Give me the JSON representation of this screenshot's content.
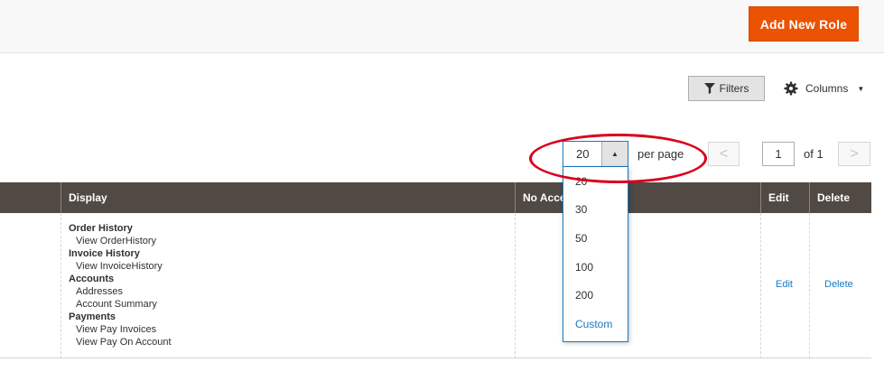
{
  "header": {
    "add_button_label": "Add New Role"
  },
  "toolbar": {
    "filters_label": "Filters",
    "columns_label": "Columns",
    "icons": [
      "filter-icon",
      "gear-icon",
      "caret-down-icon"
    ]
  },
  "pagination": {
    "per_page_value": "20",
    "per_page_label": "per page",
    "options": [
      "20",
      "30",
      "50",
      "100",
      "200",
      "Custom"
    ],
    "current_page": "1",
    "total_pages_label": "of 1",
    "prev_glyph": "<",
    "next_glyph": ">"
  },
  "grid": {
    "columns": [
      "Display",
      "No Access",
      "Edit",
      "Delete"
    ],
    "row": {
      "permissions": [
        {
          "group": "Order History",
          "items": [
            "View OrderHistory"
          ]
        },
        {
          "group": "Invoice History",
          "items": [
            "View InvoiceHistory"
          ]
        },
        {
          "group": "Accounts",
          "items": [
            "Addresses",
            "Account Summary"
          ]
        },
        {
          "group": "Payments",
          "items": [
            "View Pay Invoices",
            "View Pay On Account"
          ]
        }
      ],
      "edit_label": "Edit",
      "delete_label": "Delete"
    }
  },
  "colors": {
    "accent": "#eb5202",
    "header_bg": "#514943",
    "link": "#1979c3",
    "highlight": "#d9001b"
  }
}
